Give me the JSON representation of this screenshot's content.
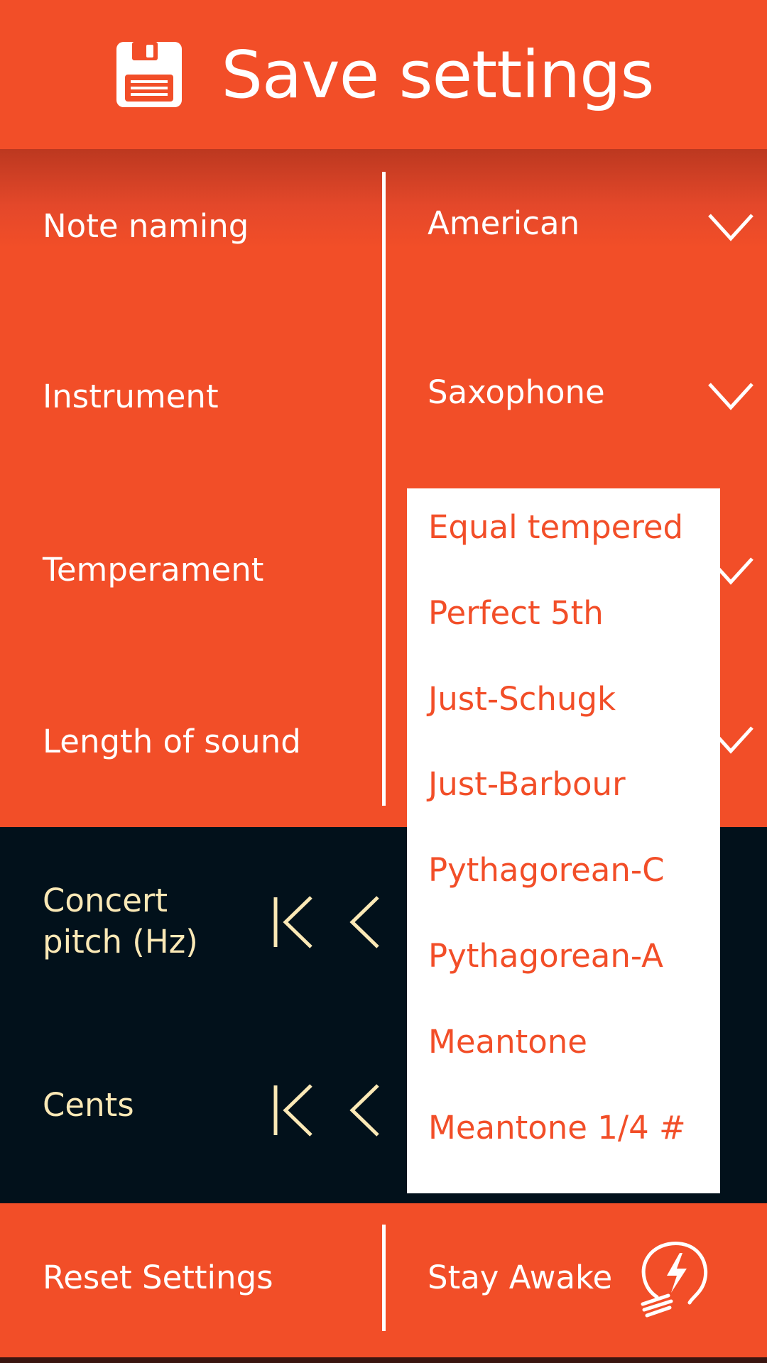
{
  "header": {
    "title": "Save settings",
    "icon": "floppy-disk-icon"
  },
  "settings": [
    {
      "label": "Note naming",
      "value": "American"
    },
    {
      "label": "Instrument",
      "value": "Saxophone"
    },
    {
      "label": "Temperament",
      "value": ""
    },
    {
      "label": "Length of sound",
      "value": ""
    }
  ],
  "pitch": {
    "concert_line1": "Concert",
    "concert_line2": "pitch (Hz)",
    "cents_label": "Cents"
  },
  "dropdown": {
    "options": [
      "Equal tempered",
      "Perfect 5th",
      "Just-Schugk",
      "Just-Barbour",
      "Pythagorean-C",
      "Pythagorean-A",
      "Meantone",
      "Meantone 1/4 #"
    ]
  },
  "footer": {
    "reset_label": "Reset Settings",
    "awake_label": "Stay Awake",
    "awake_icon": "lightbulb-bolt-icon"
  },
  "colors": {
    "primary": "#f24e28",
    "dark": "#02111b",
    "cream": "#fbe9b6",
    "white": "#ffffff"
  }
}
